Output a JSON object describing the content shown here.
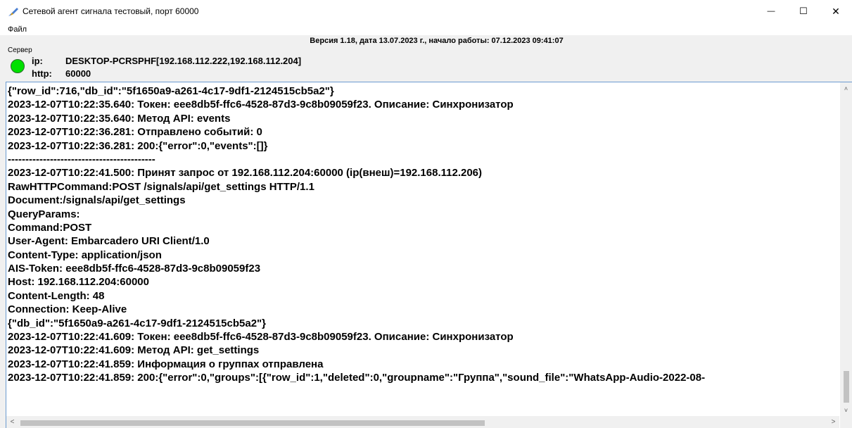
{
  "window": {
    "title": "Сетевой агент сигнала тестовый, порт 60000",
    "minimize": "—",
    "maximize": "☐",
    "close": "✕"
  },
  "menu": {
    "file": "Файл"
  },
  "version_line": "Версия 1.18, дата 13.07.2023 г., начало работы: 07.12.2023 09:41:07",
  "server": {
    "caption": "Сервер",
    "status_color": "#00e000",
    "ip_label": "ip:",
    "ip_value": "DESKTOP-PCRSPHF[192.168.112.222,192.168.112.204]",
    "http_label": "http:",
    "http_value": "60000"
  },
  "log": [
    "{\"row_id\":716,\"db_id\":\"5f1650a9-a261-4c17-9df1-2124515cb5a2\"}",
    "2023-12-07T10:22:35.640: Токен: eee8db5f-ffc6-4528-87d3-9c8b09059f23. Описание: Синхронизатор",
    "2023-12-07T10:22:35.640: Метод API: events",
    "2023-12-07T10:22:36.281: Отправлено событий: 0",
    "2023-12-07T10:22:36.281: 200:{\"error\":0,\"events\":[]}",
    "------------------------------------------",
    "2023-12-07T10:22:41.500: Принят запрос от 192.168.112.204:60000 (ip(внеш)=192.168.112.206)",
    "RawHTTPCommand:POST /signals/api/get_settings HTTP/1.1",
    "Document:/signals/api/get_settings",
    "QueryParams:",
    "Command:POST",
    "User-Agent: Embarcadero URI Client/1.0",
    "Content-Type: application/json",
    "AIS-Token: eee8db5f-ffc6-4528-87d3-9c8b09059f23",
    "Host: 192.168.112.204:60000",
    "Content-Length: 48",
    "Connection: Keep-Alive",
    "{\"db_id\":\"5f1650a9-a261-4c17-9df1-2124515cb5a2\"}",
    "2023-12-07T10:22:41.609: Токен: eee8db5f-ffc6-4528-87d3-9c8b09059f23. Описание: Синхронизатор",
    "2023-12-07T10:22:41.609: Метод API: get_settings",
    "2023-12-07T10:22:41.859: Информация о группах отправлена",
    "2023-12-07T10:22:41.859: 200:{\"error\":0,\"groups\":[{\"row_id\":1,\"deleted\":0,\"groupname\":\"Группа\",\"sound_file\":\"WhatsApp-Audio-2022-08-"
  ],
  "scrollbars": {
    "up": "˄",
    "down": "˅",
    "left": "<",
    "right": ">"
  }
}
